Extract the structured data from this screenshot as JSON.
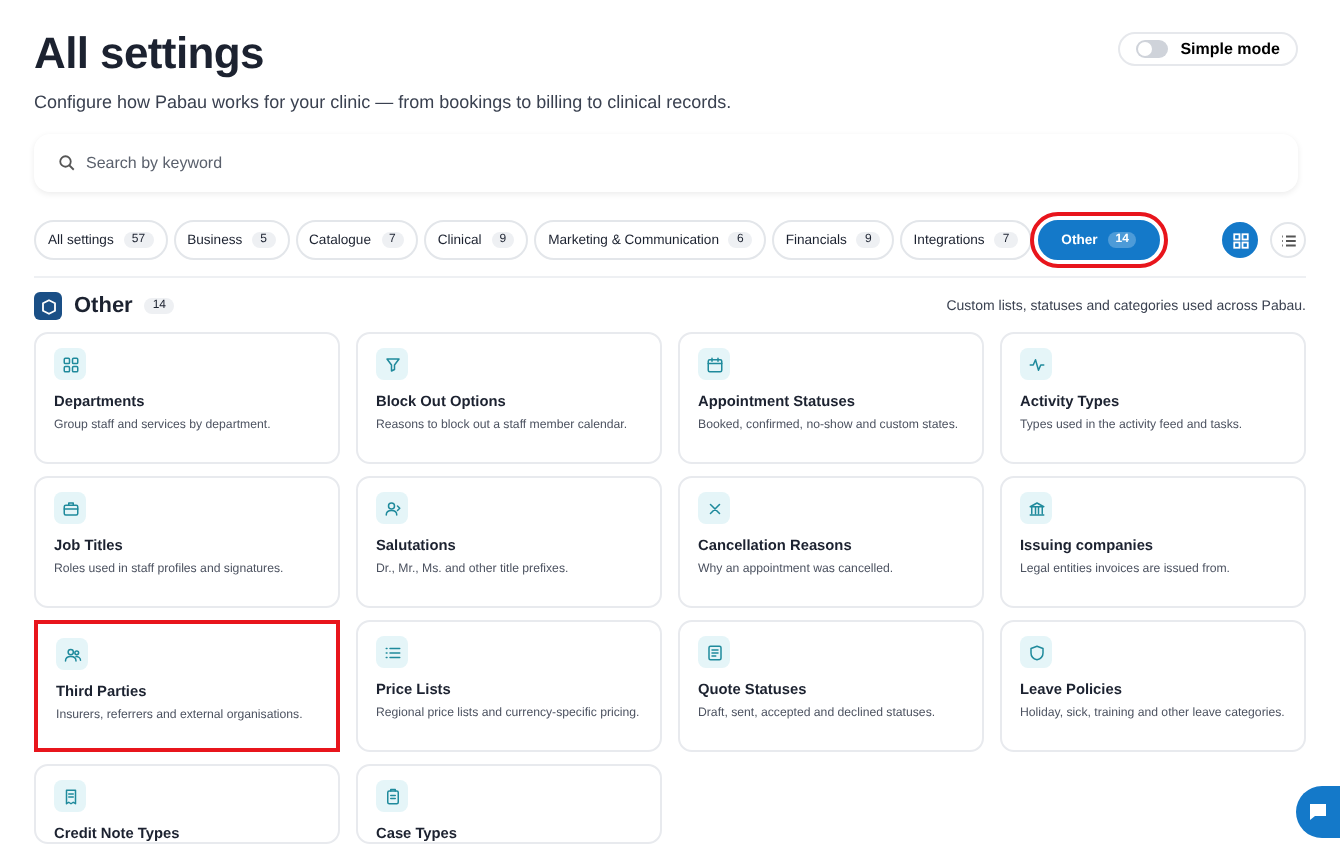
{
  "header": {
    "title": "All settings",
    "subtitle": "Configure how Pabau works for your clinic — from bookings to billing to clinical records.",
    "simple_mode": {
      "label": "Simple mode",
      "on": false
    }
  },
  "search": {
    "placeholder": "Search by keyword"
  },
  "tabs": [
    {
      "label": "All settings",
      "count": "57",
      "selected": false,
      "highlighted": false
    },
    {
      "label": "Business",
      "count": "5",
      "selected": false,
      "highlighted": false
    },
    {
      "label": "Catalogue",
      "count": "7",
      "selected": false,
      "highlighted": false
    },
    {
      "label": "Clinical",
      "count": "9",
      "selected": false,
      "highlighted": false
    },
    {
      "label": "Marketing & Communication",
      "count": "6",
      "selected": false,
      "highlighted": false
    },
    {
      "label": "Financials",
      "count": "9",
      "selected": false,
      "highlighted": false
    },
    {
      "label": "Integrations",
      "count": "7",
      "selected": false,
      "highlighted": false
    },
    {
      "label": "Other",
      "count": "14",
      "selected": true,
      "highlighted": true
    }
  ],
  "view_modes": [
    {
      "kind": "grid",
      "selected": true
    },
    {
      "kind": "list",
      "selected": false
    }
  ],
  "section": {
    "title": "Other",
    "count": "14",
    "description": "Custom lists, statuses and categories used across Pabau."
  },
  "cards": [
    {
      "kind": "grid",
      "title": "Departments",
      "description": "Group staff and services by department.",
      "highlighted": false
    },
    {
      "kind": "filter",
      "title": "Block Out Options",
      "description": "Reasons to block out a staff member calendar.",
      "highlighted": false
    },
    {
      "kind": "calendar",
      "title": "Appointment Statuses",
      "description": "Booked, confirmed, no-show and custom states.",
      "highlighted": false
    },
    {
      "kind": "pulse",
      "title": "Activity Types",
      "description": "Types used in the activity feed and tasks.",
      "highlighted": false
    },
    {
      "kind": "briefcase",
      "title": "Job Titles",
      "description": "Roles used in staff profiles and signatures.",
      "highlighted": false
    },
    {
      "kind": "person",
      "title": "Salutations",
      "description": "Dr., Mr., Ms. and other title prefixes.",
      "highlighted": false
    },
    {
      "kind": "cross",
      "title": "Cancellation Reasons",
      "description": "Why an appointment was cancelled.",
      "highlighted": false
    },
    {
      "kind": "bank",
      "title": "Issuing companies",
      "description": "Legal entities invoices are issued from.",
      "highlighted": false
    },
    {
      "kind": "people",
      "title": "Third Parties",
      "description": "Insurers, referrers and external organisations.",
      "highlighted": true
    },
    {
      "kind": "list",
      "title": "Price Lists",
      "description": "Regional price lists and currency-specific pricing.",
      "highlighted": false
    },
    {
      "kind": "document",
      "title": "Quote Statuses",
      "description": "Draft, sent, accepted and declined statuses.",
      "highlighted": false
    },
    {
      "kind": "shield",
      "title": "Leave Policies",
      "description": "Holiday, sick, training and other leave categories.",
      "highlighted": false
    },
    {
      "kind": "receipt",
      "title": "Credit Note Types",
      "highlighted": false
    },
    {
      "kind": "clipboard",
      "title": "Case Types",
      "highlighted": false
    }
  ]
}
